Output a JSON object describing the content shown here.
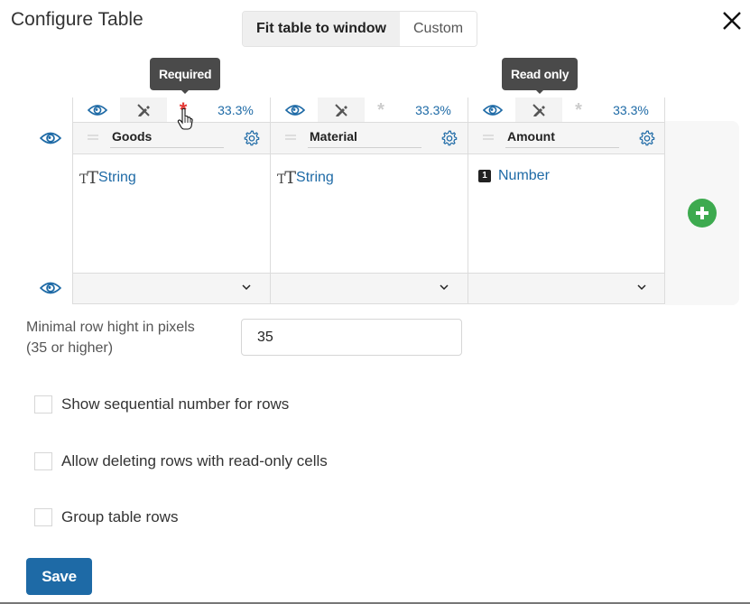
{
  "dialog": {
    "title": "Configure Table",
    "close_icon": "close-icon"
  },
  "width_mode": {
    "options": [
      "Fit table to window",
      "Custom"
    ],
    "selected": "Fit table to window"
  },
  "tooltips": {
    "required": "Required",
    "read_only": "Read only"
  },
  "columns": [
    {
      "name": "Goods",
      "type": "String",
      "type_icon": "text-type-icon",
      "width": "33.3%",
      "required": true,
      "read_only": false,
      "visible": true
    },
    {
      "name": "Material",
      "type": "String",
      "type_icon": "text-type-icon",
      "width": "33.3%",
      "required": false,
      "read_only": false,
      "visible": true
    },
    {
      "name": "Amount",
      "type": "Number",
      "type_icon": "number-type-icon",
      "type_icon_glyph": "1",
      "width": "33.3%",
      "required": false,
      "read_only": false,
      "visible": true
    }
  ],
  "icons": {
    "visibility": "eye-icon",
    "read_only": "pencil-off-icon",
    "required": "asterisk-icon",
    "settings": "gear-icon",
    "drag": "drag-handle-icon",
    "expand": "chevron-down-icon",
    "add_column": "plus-circle-icon"
  },
  "type_text_glyph_small": "T",
  "type_text_glyph_big": "T",
  "colors": {
    "accent": "#1e6aa6",
    "required": "#e53935",
    "add": "#3daa4f",
    "tooltip_bg": "#4a4a4a"
  },
  "settings": {
    "min_row_height_label_line1": "Minimal row hight in pixels",
    "min_row_height_label_line2": "(35 or higher)",
    "min_row_height_value": "35",
    "checkboxes": [
      {
        "label": "Show sequential number for rows",
        "checked": false
      },
      {
        "label": "Allow deleting rows with read-only cells",
        "checked": false
      },
      {
        "label": "Group table rows",
        "checked": false
      }
    ]
  },
  "footer": {
    "save_label": "Save"
  }
}
